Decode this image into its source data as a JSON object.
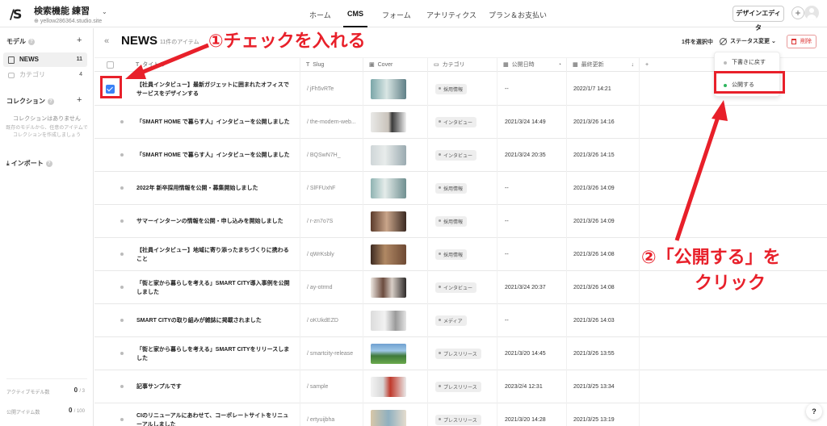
{
  "app": {
    "logo": "/S",
    "project_name": "検索機能 練習",
    "project_domain": "yellow286364.studio.site"
  },
  "nav": {
    "tabs": [
      "ホーム",
      "CMS",
      "フォーム",
      "アナリティクス",
      "プラン＆お支払い"
    ],
    "active": "CMS",
    "design_editor_label": "デザインエディタ",
    "add_label": "+"
  },
  "sidebar": {
    "models_label": "モデル",
    "models": [
      {
        "label": "NEWS",
        "count": "11",
        "selected": true
      },
      {
        "label": "カテゴリ",
        "count": "4",
        "selected": false
      }
    ],
    "collections_label": "コレクション",
    "collections_empty": "コレクションはありません",
    "collections_hint_1": "既存のモデルから、任意のアイテムで",
    "collections_hint_2": "コレクションを作成しましょう",
    "import_label": "インポート",
    "active_models_label": "アクティブモデル数",
    "active_models_value": "0",
    "active_models_max": "/ 3",
    "published_items_label": "公開アイテム数",
    "published_items_value": "0",
    "published_items_max": "/ 100"
  },
  "main": {
    "title": "NEWS",
    "item_count": "11件のアイテム",
    "selected_count": "1件を選択中",
    "status_change_label": "ステータス変更",
    "delete_label": "削除",
    "status_menu": [
      "下書きに戻す",
      "公開する"
    ],
    "columns": [
      "タイトル",
      "Slug",
      "Cover",
      "カテゴリ",
      "公開日時",
      "最終更新"
    ],
    "rows": [
      {
        "title": "【社員インタビュー】最新ガジェットに囲まれたオフィスでサービスをデザインする",
        "slug": "/ jFh5vRTe",
        "category": "採用情報",
        "published": "--",
        "updated": "2022/1/7 14:21"
      },
      {
        "title": "「SMART HOME で暮らす人」インタビューを公開しました",
        "slug": "/ the-modern-web...",
        "category": "インタビュー",
        "published": "2021/3/24 14:49",
        "updated": "2021/3/26 14:16"
      },
      {
        "title": "「SMART HOME で暮らす人」インタビューを公開しました",
        "slug": "/ BQSwN7H_",
        "category": "インタビュー",
        "published": "2021/3/24 20:35",
        "updated": "2021/3/26 14:15"
      },
      {
        "title": "2022年 新卒採用情報を公開・募集開始しました",
        "slug": "/ SlFFUxhF",
        "category": "採用情報",
        "published": "--",
        "updated": "2021/3/26 14:09"
      },
      {
        "title": "サマーインターンの情報を公開・申し込みを開始しました",
        "slug": "/ r-zn7o7S",
        "category": "採用情報",
        "published": "--",
        "updated": "2021/3/26 14:09"
      },
      {
        "title": "【社員インタビュー】地域に寄り添ったまちづくりに携わること",
        "slug": "/ qWrKsbly",
        "category": "採用情報",
        "published": "--",
        "updated": "2021/3/26 14:08"
      },
      {
        "title": "「街と家から暮らしを考える」SMART CITY導入事例を公開しました",
        "slug": "/ ay-otrmd",
        "category": "インタビュー",
        "published": "2021/3/24 20:37",
        "updated": "2021/3/26 14:08"
      },
      {
        "title": "SMART CITYの取り組みが雑誌に掲載されました",
        "slug": "/ oKUkdEZD",
        "category": "メディア",
        "published": "--",
        "updated": "2021/3/26 14:03"
      },
      {
        "title": "「街と家から暮らしを考える」SMART CITYをリリースしました",
        "slug": "/ smartcity-release",
        "category": "プレスリリース",
        "published": "2021/3/20 14:45",
        "updated": "2021/3/26 13:55"
      },
      {
        "title": "記事サンプルです",
        "slug": "/ sample",
        "category": "プレスリリース",
        "published": "2023/2/4 12:31",
        "updated": "2021/3/25 13:34"
      },
      {
        "title": "CIのリニューアルにあわせて、コーポレートサイトをリニューアルしました",
        "slug": "/ ertyuijbha",
        "category": "プレスリリース",
        "published": "2021/3/20 14:28",
        "updated": "2021/3/25 13:19"
      }
    ]
  },
  "annotations": {
    "step1": "①チェックを入れる",
    "step2_line1": "②「公開する」を",
    "step2_line2": "クリック",
    "color": "#e8202a"
  },
  "help_label": "?"
}
